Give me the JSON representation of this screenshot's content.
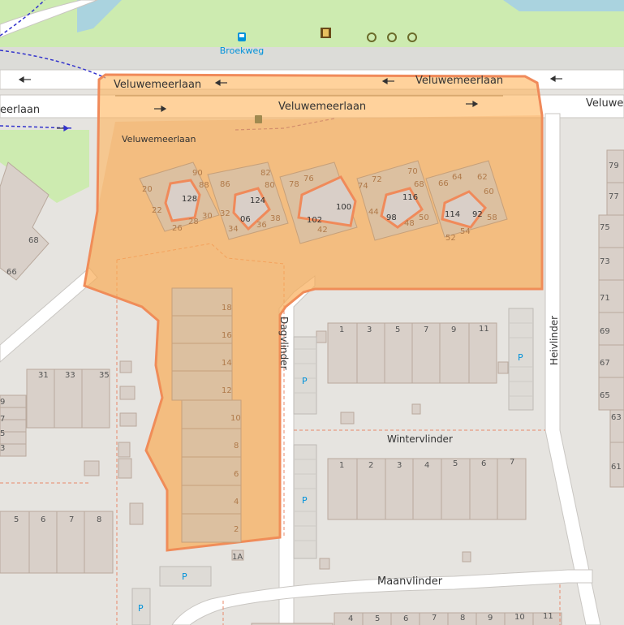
{
  "colors": {
    "background": "#e6e4e0",
    "grass": "#cdebb0",
    "water": "#aad3df",
    "road": "#ffffff",
    "building": "#d9d0c9",
    "highlight_fill": "#ffb45a",
    "highlight_stroke": "#f08a5a",
    "boundary_dash": "#e8896a",
    "busroute": "#3333cc",
    "parking_text": "#0092da"
  },
  "icons": [
    "bus-stop-icon",
    "bicycle-sign-icon",
    "recycling-icon",
    "arrow-icon"
  ],
  "bus_stop_label": "Broekweg",
  "streets": {
    "veluwemeerlaan_top_left": "Veluwemeerlaan",
    "veluwemeerlaan_top_right": "Veluwemeerlaan",
    "veluwemeerlaan_middle": "Veluwemeerlaan",
    "veluwemeerlaan_left_edge": "eerlaan",
    "veluwemeerlaan_right_edge": "Veluwe",
    "veluwemeerlaan_service": "Veluwemeerlaan",
    "dagvlinder": "Dagvlinder",
    "heivlinder": "Heivlinder",
    "wintervlinder": "Wintervlinder",
    "maanvlinder": "Maanvlinder"
  },
  "parking_label": "P",
  "house_numbers": {
    "cluster_1": [
      "90",
      "88",
      "20",
      "22",
      "128",
      "26",
      "28",
      "30"
    ],
    "cluster_2": [
      "86",
      "82",
      "80",
      "124",
      "32",
      "06",
      "34",
      "36",
      "38"
    ],
    "cluster_3": [
      "78",
      "76",
      "100",
      "102",
      "42"
    ],
    "cluster_4": [
      "74",
      "72",
      "70",
      "68",
      "116",
      "44",
      "98",
      "48",
      "50"
    ],
    "cluster_5": [
      "66",
      "64",
      "62",
      "60",
      "114",
      "92",
      "58",
      "52",
      "54"
    ],
    "dagvlinder_row": [
      "18",
      "16",
      "14",
      "12",
      "10",
      "8",
      "6",
      "4",
      "2"
    ],
    "dagvlinder_extra": "1A",
    "row_north": [
      "1",
      "3",
      "5",
      "7",
      "9",
      "11"
    ],
    "row_wintervlinder": [
      "1",
      "2",
      "3",
      "4",
      "5",
      "6",
      "7"
    ],
    "row_maanvlinder": [
      "4",
      "5",
      "6",
      "7",
      "8",
      "9",
      "10",
      "11"
    ],
    "row_left_top": [
      "31",
      "33",
      "35"
    ],
    "row_left_bottom": [
      "5",
      "6",
      "7",
      "8"
    ],
    "row_left_small": [
      "9",
      "7",
      "5",
      "3"
    ],
    "heivlinder_row": [
      "79",
      "77",
      "75",
      "73",
      "71",
      "69",
      "67",
      "65",
      "63",
      "61"
    ],
    "far_left": [
      "68",
      "66"
    ]
  }
}
